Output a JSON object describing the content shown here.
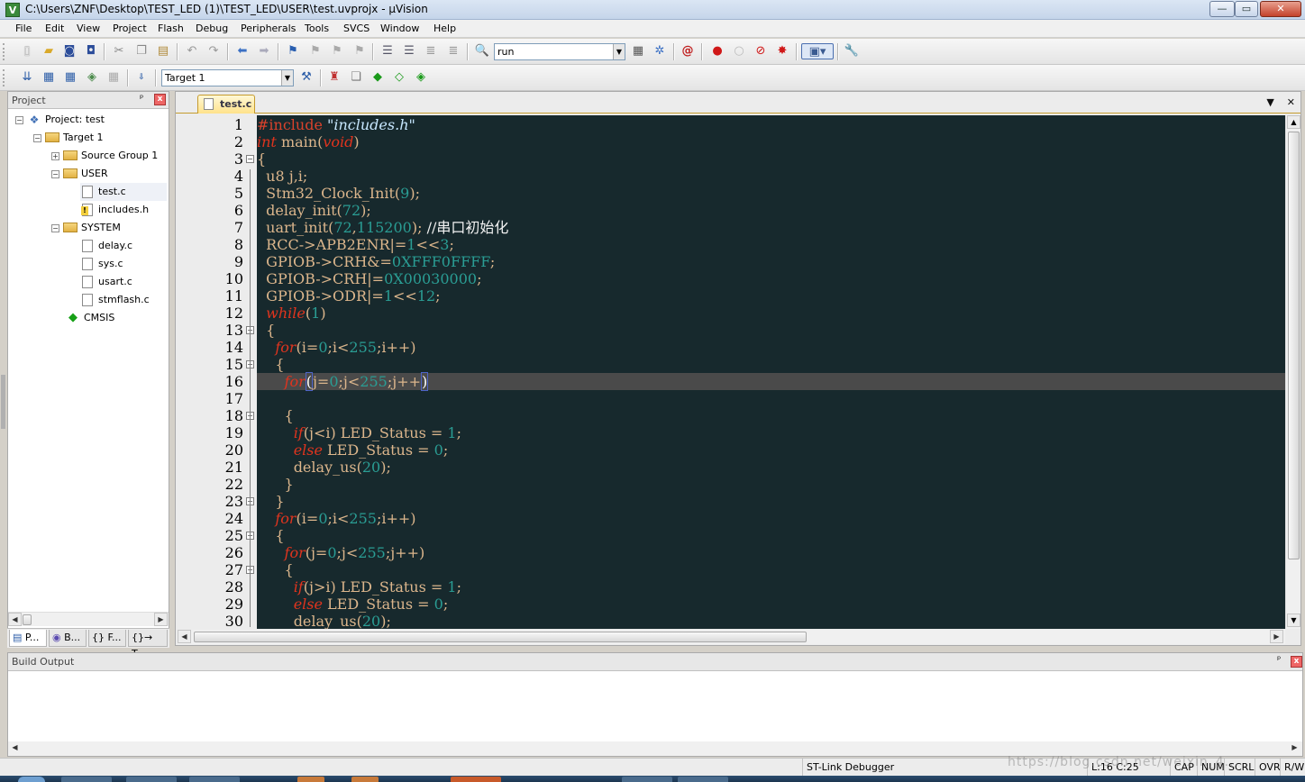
{
  "window": {
    "title": "C:\\Users\\ZNF\\Desktop\\TEST_LED (1)\\TEST_LED\\USER\\test.uvprojx - µVision",
    "app_icon": "V",
    "minimize": "—",
    "maximize": "▭",
    "close": "✕"
  },
  "menu": [
    "File",
    "Edit",
    "View",
    "Project",
    "Flash",
    "Debug",
    "Peripherals",
    "Tools",
    "SVCS",
    "Window",
    "Help"
  ],
  "toolbar1": {
    "find_combo_value": "run"
  },
  "toolbar2": {
    "target_combo_value": "Target 1"
  },
  "project_panel": {
    "title": "Project",
    "pin": "ᵖ",
    "close": "x",
    "tree": {
      "project": "Project: test",
      "target": "Target 1",
      "source_group": "Source Group 1",
      "user_group": "USER",
      "user_files": [
        "test.c",
        "includes.h"
      ],
      "system_group": "SYSTEM",
      "system_files": [
        "delay.c",
        "sys.c",
        "usart.c",
        "stmflash.c"
      ],
      "cmsis": "CMSIS"
    },
    "tabs": [
      "P...",
      "B...",
      "{} F...",
      "{}→ T..."
    ]
  },
  "editor": {
    "tab_title": "test.c",
    "current_line": 16,
    "line_numbers": [
      1,
      2,
      3,
      4,
      5,
      6,
      7,
      8,
      9,
      10,
      11,
      12,
      13,
      14,
      15,
      16,
      17,
      18,
      19,
      20,
      21,
      22,
      23,
      24,
      25,
      26,
      27,
      28,
      29,
      30
    ]
  },
  "build_output": {
    "title": "Build Output"
  },
  "status_bar": {
    "debugger": "ST-Link Debugger",
    "position": "L:16 C:25",
    "caps": "CAP",
    "num": "NUM",
    "scrl": "SCRL",
    "ovr": "OVR",
    "rw": "R/W"
  },
  "watermark": "https://blog.csdn.net/weixin_4..."
}
